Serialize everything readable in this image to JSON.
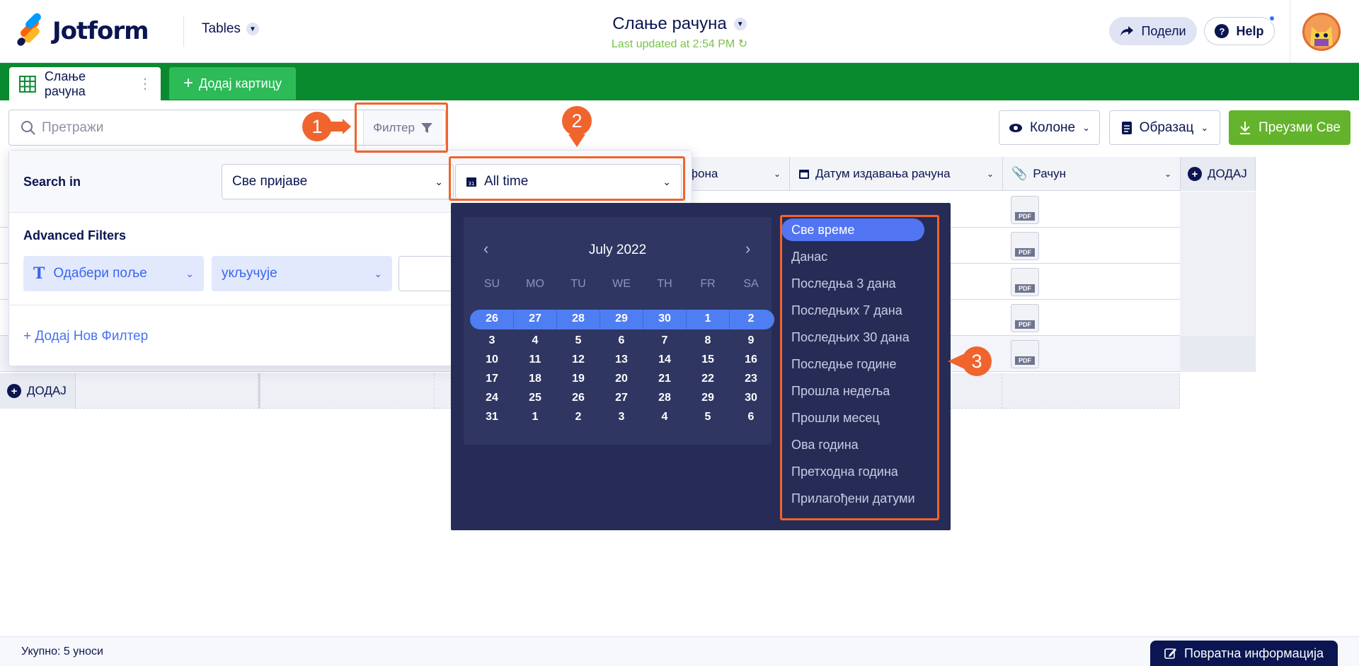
{
  "header": {
    "logo_text": "Jotform",
    "tables_label": "Tables",
    "title": "Слање рачуна",
    "subtitle": "Last updated at 2:54 PM",
    "share_label": "Подели",
    "help_label": "Help"
  },
  "tabs": {
    "active_label": "Слање рачуна",
    "add_label": "Додај картицу"
  },
  "toolbar": {
    "search_placeholder": "Претражи",
    "filter_label": "Филтер",
    "columns_label": "Колоне",
    "form_label": "Образац",
    "download_label": "Преузми Све"
  },
  "table": {
    "columns": [
      {
        "label": "фона"
      },
      {
        "label": "Датум издавања рачуна"
      },
      {
        "label": "Рачун"
      }
    ],
    "add_column_label": "ДОДАЈ",
    "add_row_label": "ДОДАЈ",
    "pdf_label": "PDF"
  },
  "filter_panel": {
    "search_in_label": "Search in",
    "search_in_value": "Све пријаве",
    "date_range_value": "All time",
    "advanced_label": "Advanced Filters",
    "field_select": "Одабери поље",
    "operator_select": "укључује",
    "add_filter_label": "+ Додај Нов Филтер"
  },
  "calendar": {
    "month": "July 2022",
    "weekdays": [
      "SU",
      "MO",
      "TU",
      "WE",
      "TH",
      "FR",
      "SA"
    ],
    "weeks": [
      [
        "26",
        "27",
        "28",
        "29",
        "30",
        "1",
        "2"
      ],
      [
        "3",
        "4",
        "5",
        "6",
        "7",
        "8",
        "9"
      ],
      [
        "10",
        "11",
        "12",
        "13",
        "14",
        "15",
        "16"
      ],
      [
        "17",
        "18",
        "19",
        "20",
        "21",
        "22",
        "23"
      ],
      [
        "24",
        "25",
        "26",
        "27",
        "28",
        "29",
        "30"
      ],
      [
        "31",
        "1",
        "2",
        "3",
        "4",
        "5",
        "6"
      ]
    ]
  },
  "presets": [
    "Све време",
    "Данас",
    "Последња 3 дана",
    "Последњих 7 дана",
    "Последњих 30 дана",
    "Последње године",
    "Прошла недеља",
    "Прошли месец",
    "Ова година",
    "Претходна година",
    "Прилагођени датуми"
  ],
  "annotations": [
    "1",
    "2",
    "3"
  ],
  "footer": {
    "total_label": "Укупно: 5 уноси",
    "feedback_label": "Повратна информација"
  },
  "colors": {
    "tabbar_green": "#0a8a2f",
    "download_green": "#64b32c",
    "dropdown_bg": "#262c56",
    "accent_blue": "#4f7ef2",
    "annotation_orange": "#f0642d"
  }
}
